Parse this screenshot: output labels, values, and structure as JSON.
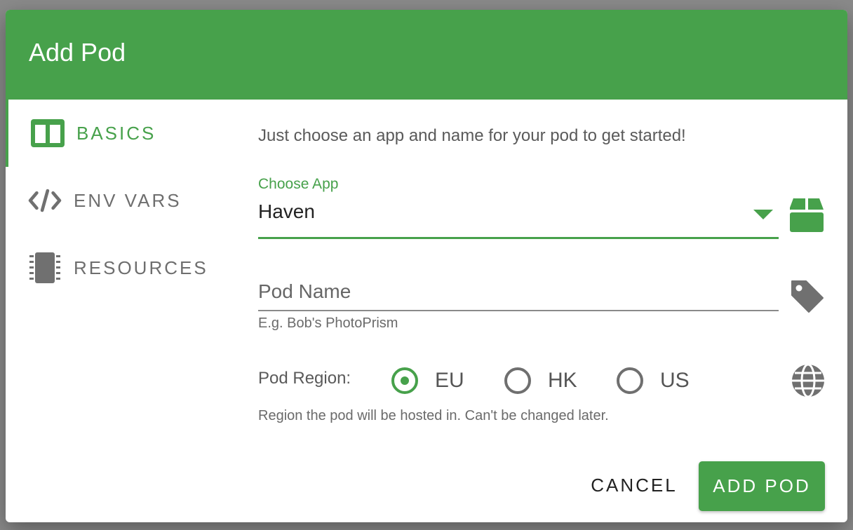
{
  "dialog": {
    "title": "Add Pod"
  },
  "sidebar": {
    "items": [
      {
        "label": "BASICS",
        "icon": "columns-icon",
        "active": true
      },
      {
        "label": "ENV VARS",
        "icon": "code-icon",
        "active": false
      },
      {
        "label": "RESOURCES",
        "icon": "chip-icon",
        "active": false
      }
    ]
  },
  "main": {
    "intro": "Just choose an app and name for your pod to get started!",
    "app_select": {
      "label": "Choose App",
      "value": "Haven",
      "icon": "package-icon"
    },
    "pod_name": {
      "placeholder": "Pod Name",
      "value": "",
      "hint": "E.g. Bob's PhotoPrism",
      "icon": "tag-icon"
    },
    "region": {
      "label": "Pod Region:",
      "options": [
        {
          "label": "EU",
          "checked": true
        },
        {
          "label": "HK",
          "checked": false
        },
        {
          "label": "US",
          "checked": false
        }
      ],
      "hint": "Region the pod will be hosted in. Can't be changed later.",
      "icon": "globe-icon"
    }
  },
  "actions": {
    "cancel": "CANCEL",
    "submit": "ADD POD"
  },
  "colors": {
    "accent": "#47a14b",
    "icon_gray": "#707070"
  }
}
